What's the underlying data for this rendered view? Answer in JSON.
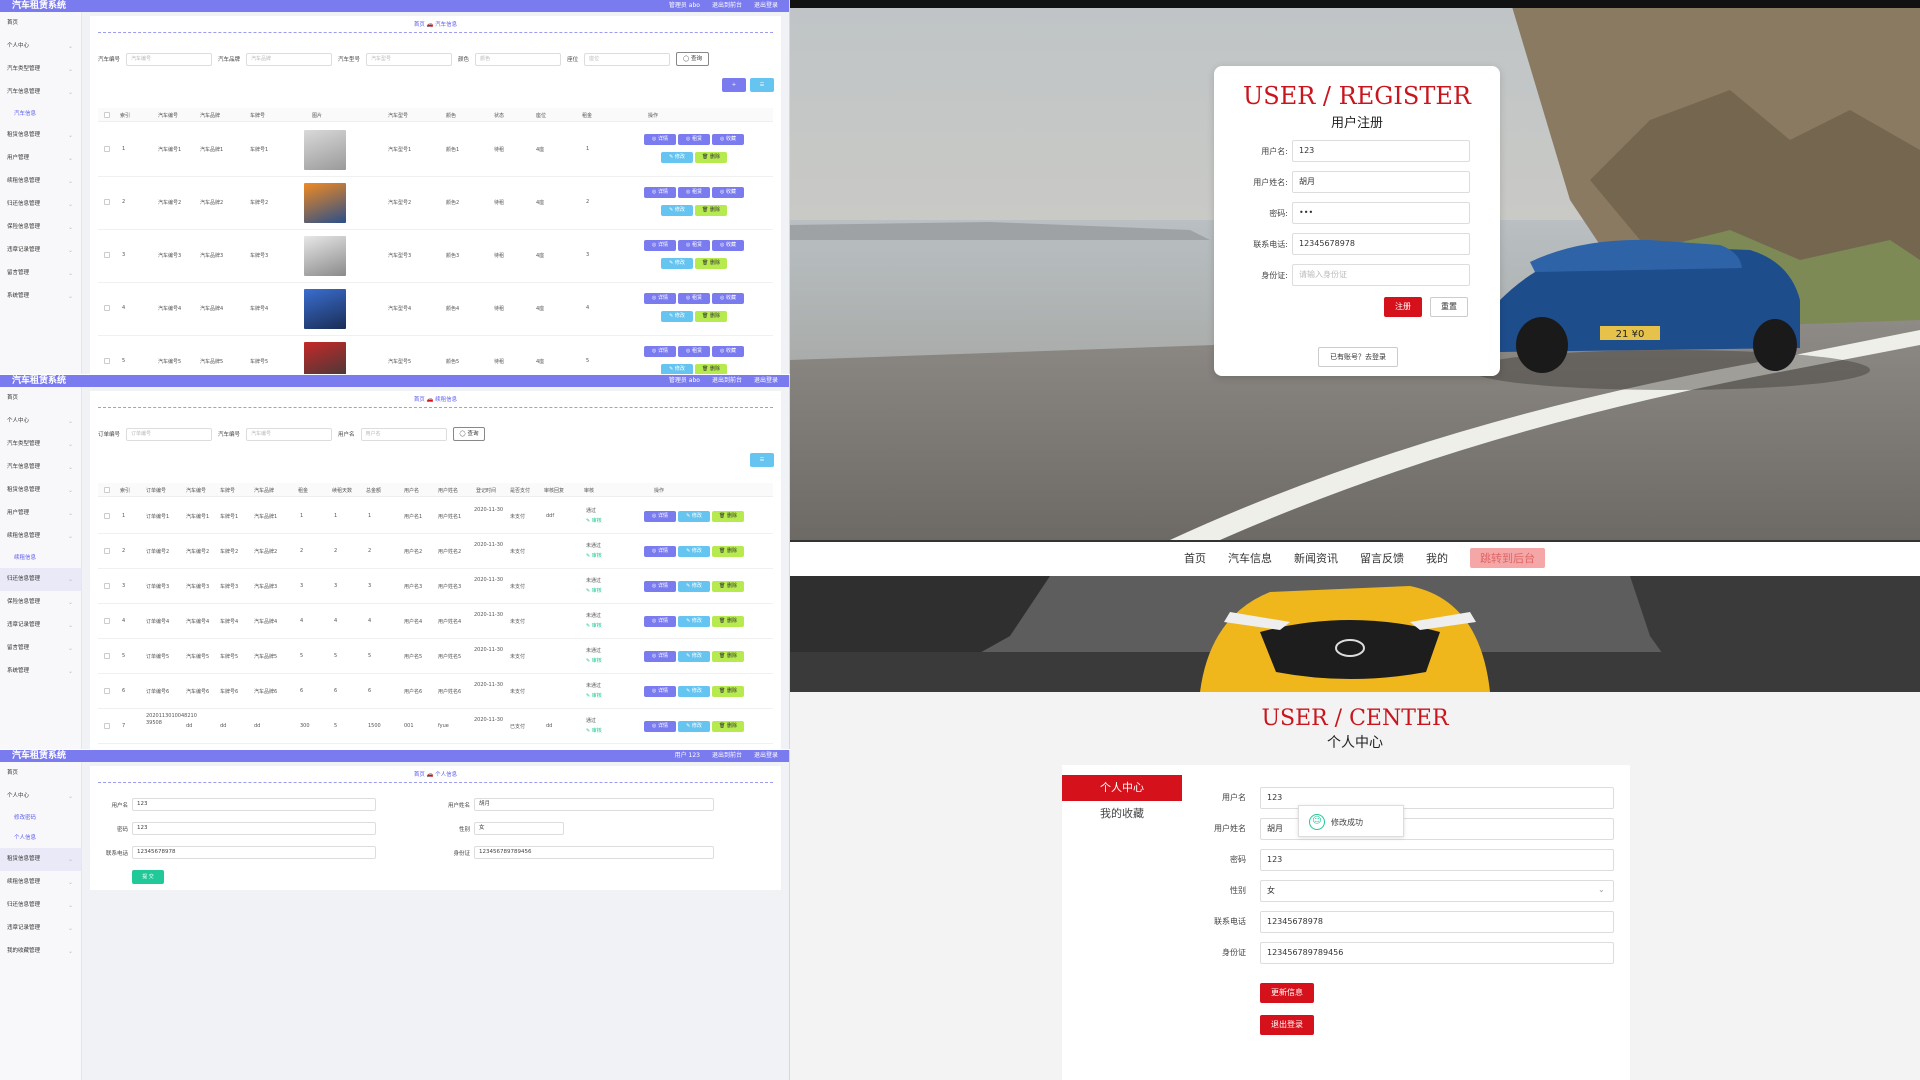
{
  "admin": {
    "brand": "汽车租赁系统",
    "header_links_admin": [
      "管理员 abo",
      "退出到前台",
      "退出登录"
    ],
    "header_links_user": [
      "用户 123",
      "退出到前台",
      "退出登录"
    ],
    "sidebar1": [
      "首页",
      "个人中心",
      "汽车类型管理",
      "汽车信息管理",
      "汽车信息",
      "租赁信息管理",
      "用户管理",
      "续租信息管理",
      "归还信息管理",
      "保险信息管理",
      "违章记录管理",
      "留言管理",
      "系统管理"
    ],
    "sidebar2": [
      "首页",
      "个人中心",
      "汽车类型管理",
      "汽车信息管理",
      "租赁信息管理",
      "用户管理",
      "续租信息管理",
      "续租信息",
      "归还信息管理",
      "保险信息管理",
      "违章记录管理",
      "留言管理",
      "系统管理"
    ],
    "sidebar3": [
      "首页",
      "个人中心",
      "修改密码",
      "个人信息",
      "租赁信息管理",
      "续租信息管理",
      "归还信息管理",
      "违章记录管理",
      "我的收藏管理"
    ],
    "p1": {
      "crumb": "首页 🚗 汽车信息",
      "filters": [
        {
          "label": "汽车编号",
          "ph": "汽车编号"
        },
        {
          "label": "汽车品牌",
          "ph": "汽车品牌"
        },
        {
          "label": "汽车型号",
          "ph": "汽车型号"
        },
        {
          "label": "颜色",
          "ph": "颜色"
        },
        {
          "label": "座位",
          "ph": "座位"
        }
      ],
      "search": "◯ 查询",
      "add": "+",
      "del": "☰",
      "headers": [
        "索引",
        "汽车编号",
        "汽车品牌",
        "车牌号",
        "图片",
        "汽车型号",
        "颜色",
        "状态",
        "座位",
        "租金",
        "操作"
      ],
      "rows": [
        [
          "1",
          "汽车编号1",
          "汽车品牌1",
          "车牌号1",
          "汽车型号1",
          "颜色1",
          "待租",
          "4座",
          "1"
        ],
        [
          "2",
          "汽车编号2",
          "汽车品牌2",
          "车牌号2",
          "汽车型号2",
          "颜色2",
          "待租",
          "4座",
          "2"
        ],
        [
          "3",
          "汽车编号3",
          "汽车品牌3",
          "车牌号3",
          "汽车型号3",
          "颜色3",
          "待租",
          "4座",
          "3"
        ],
        [
          "4",
          "汽车编号4",
          "汽车品牌4",
          "车牌号4",
          "汽车型号4",
          "颜色4",
          "待租",
          "4座",
          "4"
        ],
        [
          "5",
          "汽车编号5",
          "汽车品牌5",
          "车牌号5",
          "汽车型号5",
          "颜色5",
          "待租",
          "4座",
          "5"
        ]
      ],
      "actions": [
        "◎ 详情",
        "◎ 租赁",
        "◎ 收藏",
        "✎ 修改",
        "🗑 删除"
      ]
    },
    "p2": {
      "crumb": "首页 🚗 续租信息",
      "filters": [
        {
          "label": "订单编号",
          "ph": "订单编号"
        },
        {
          "label": "汽车编号",
          "ph": "汽车编号"
        },
        {
          "label": "用户名",
          "ph": "用户名"
        }
      ],
      "search": "◯ 查询",
      "del": "☰",
      "headers": [
        "索引",
        "订单编号",
        "汽车编号",
        "车牌号",
        "汽车品牌",
        "租金",
        "续租天数",
        "总金额",
        "用户名",
        "用户姓名",
        "登记时间",
        "是否支付",
        "审核回复",
        "审核",
        "操作"
      ],
      "rows": [
        [
          "1",
          "订单编号1",
          "汽车编号1",
          "车牌号1",
          "汽车品牌1",
          "1",
          "1",
          "1",
          "用户名1",
          "用户姓名1",
          "2020-11-30",
          "未支付",
          "ddf",
          "通过",
          "✎ 审核"
        ],
        [
          "2",
          "订单编号2",
          "汽车编号2",
          "车牌号2",
          "汽车品牌2",
          "2",
          "2",
          "2",
          "用户名2",
          "用户姓名2",
          "2020-11-30",
          "未支付",
          "",
          "未通过",
          "✎ 审核"
        ],
        [
          "3",
          "订单编号3",
          "汽车编号3",
          "车牌号3",
          "汽车品牌3",
          "3",
          "3",
          "3",
          "用户名3",
          "用户姓名3",
          "2020-11-30",
          "未支付",
          "",
          "未通过",
          "✎ 审核"
        ],
        [
          "4",
          "订单编号4",
          "汽车编号4",
          "车牌号4",
          "汽车品牌4",
          "4",
          "4",
          "4",
          "用户名4",
          "用户姓名4",
          "2020-11-30",
          "未支付",
          "",
          "未通过",
          "✎ 审核"
        ],
        [
          "5",
          "订单编号5",
          "汽车编号5",
          "车牌号5",
          "汽车品牌5",
          "5",
          "5",
          "5",
          "用户名5",
          "用户姓名5",
          "2020-11-30",
          "未支付",
          "",
          "未通过",
          "✎ 审核"
        ],
        [
          "6",
          "订单编号6",
          "汽车编号6",
          "车牌号6",
          "汽车品牌6",
          "6",
          "6",
          "6",
          "用户名6",
          "用户姓名6",
          "2020-11-30",
          "未支付",
          "",
          "未通过",
          "✎ 审核"
        ],
        [
          "7",
          "2020113010048210 39508",
          "dd",
          "dd",
          "dd",
          "300",
          "5",
          "1500",
          "001",
          "fyue",
          "2020-11-30",
          "已支付",
          "dd",
          "通过",
          "✎ 审核"
        ]
      ],
      "actions": [
        "◎ 详情",
        "✎ 修改",
        "🗑 删除"
      ]
    },
    "p3": {
      "crumb": "首页 🚗 个人信息",
      "fields_left": [
        {
          "label": "用户名",
          "value": "123"
        },
        {
          "label": "密码",
          "value": "123"
        },
        {
          "label": "联系电话",
          "value": "12345678978"
        }
      ],
      "fields_right": [
        {
          "label": "用户姓名",
          "value": "胡月"
        },
        {
          "label": "性别",
          "value": "女"
        },
        {
          "label": "身份证",
          "value": "123456789789456"
        }
      ],
      "submit": "提 交"
    }
  },
  "register": {
    "title_en": "USER / REGISTER",
    "title_cn": "用户注册",
    "fields": [
      {
        "label": "用户名:",
        "value": "123",
        "ph": false
      },
      {
        "label": "用户姓名:",
        "value": "胡月",
        "ph": false
      },
      {
        "label": "密码:",
        "value": "•••",
        "ph": false
      },
      {
        "label": "联系电话:",
        "value": "12345678978",
        "ph": false
      },
      {
        "label": "身份证:",
        "value": "请输入身份证",
        "ph": true
      }
    ],
    "submit": "注册",
    "reset": "重置",
    "login_link": "已有账号？去登录",
    "plate": "21 ¥0"
  },
  "center": {
    "nav": [
      "首页",
      "汽车信息",
      "新闻资讯",
      "留言反馈",
      "我的",
      "跳转到后台"
    ],
    "title_en": "USER / CENTER",
    "title_cn": "个人中心",
    "side": [
      "个人中心",
      "我的收藏"
    ],
    "fields": [
      {
        "label": "用户名",
        "value": "123"
      },
      {
        "label": "用户姓名",
        "value": "胡月"
      },
      {
        "label": "密码",
        "value": "123"
      },
      {
        "label": "性别",
        "value": "女"
      },
      {
        "label": "联系电话",
        "value": "12345678978"
      },
      {
        "label": "身份证",
        "value": "123456789789456"
      }
    ],
    "update": "更新信息",
    "logout": "退出登录",
    "toast": "修改成功"
  },
  "colors": {
    "accent": "#7b7bf0",
    "red": "#d5121c",
    "sky": "#66c4f0",
    "lime": "#b6ea4f"
  }
}
